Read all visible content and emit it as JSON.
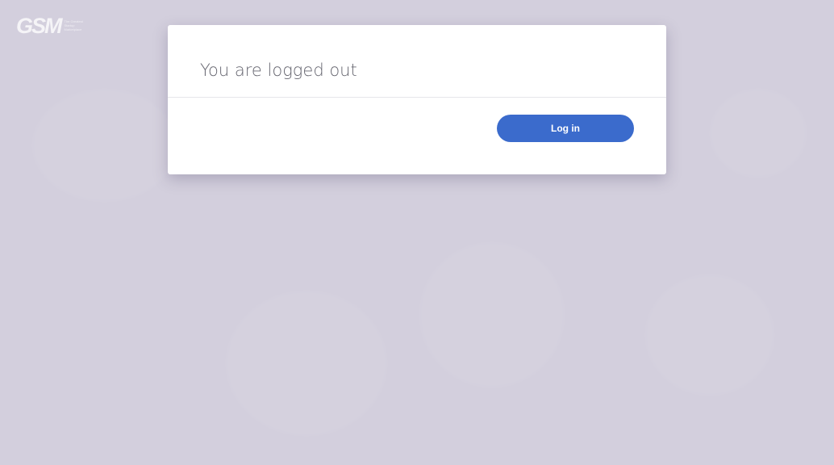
{
  "logo": {
    "mark": "GSM",
    "tagline": "The Greatest Startup Marketplace"
  },
  "modal": {
    "title": "You are logged out",
    "login_label": "Log in"
  },
  "colors": {
    "background": "#d3cfdd",
    "primary_button": "#3b6bcc"
  }
}
